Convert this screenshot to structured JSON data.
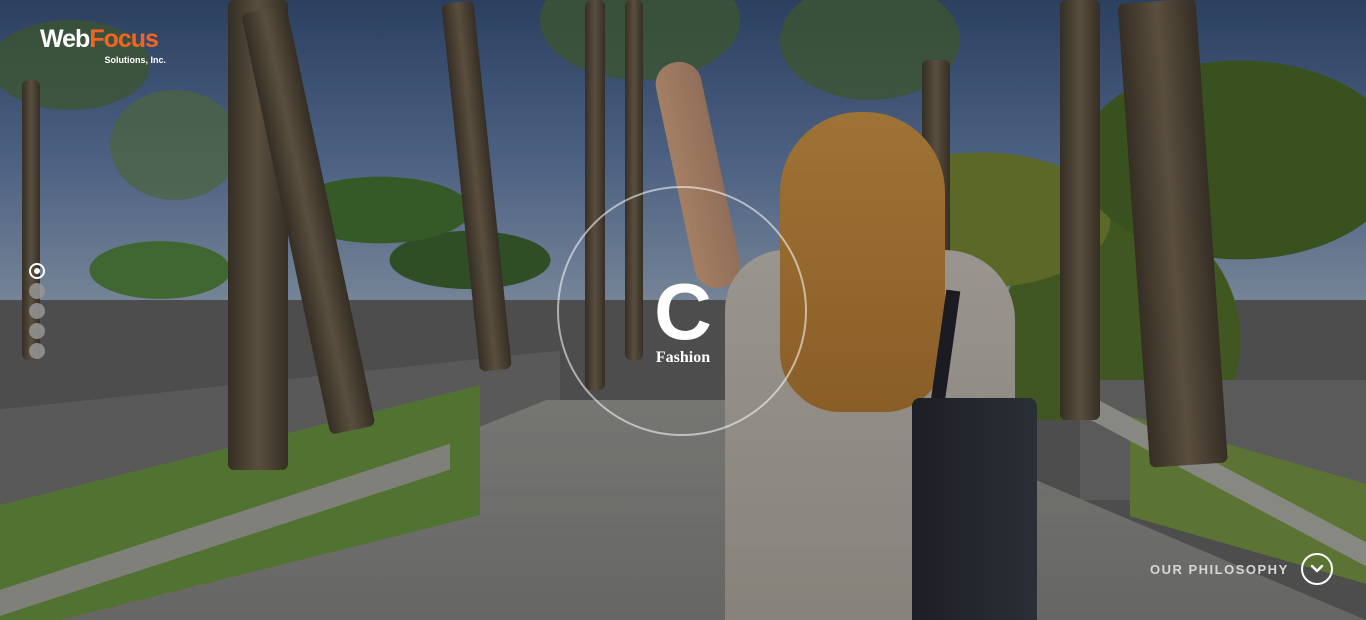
{
  "logo": {
    "word_primary": "Web",
    "word_accent": "Focus",
    "subline": "Solutions, Inc.",
    "accent_color": "#f26522"
  },
  "slider": {
    "dot_count": 5,
    "active_index": 0
  },
  "emblem": {
    "letter": "C",
    "label": "Fashion"
  },
  "philosophy": {
    "label": "OUR PHILOSOPHY",
    "icon": "chevron-down-icon"
  },
  "hero": {
    "icon": "hero-background-photo"
  }
}
